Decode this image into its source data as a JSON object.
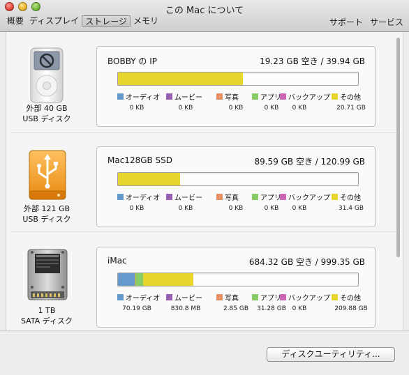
{
  "window": {
    "title": "この Mac について"
  },
  "tabs": [
    {
      "label": "概要"
    },
    {
      "label": "ディスプレイ"
    },
    {
      "label": "ストレージ",
      "active": true
    },
    {
      "label": "メモリ"
    }
  ],
  "header_links": {
    "support": "サポート",
    "service": "サービス"
  },
  "colors": {
    "audio": "#6699cc",
    "movies": "#9a5fb0",
    "photos": "#e58f62",
    "apps": "#88cc66",
    "backups": "#cc66b8",
    "other": "#e6d62e"
  },
  "legend_labels": [
    "オーディオ",
    "ムービー",
    "写真",
    "アプリ",
    "バックアップ",
    "その他"
  ],
  "devices": [
    {
      "icon": "ipod-icon",
      "label_line1": "外部 40 GB",
      "label_line2": "USB ディスク",
      "name": "BOBBY の IP",
      "capacity": "19.23 GB 空き / 39.94 GB",
      "usage_fraction": {
        "audio": 0,
        "movies": 0,
        "photos": 0,
        "apps": 0,
        "backups": 0,
        "other": 0.519
      },
      "values": [
        "0 KB",
        "0 KB",
        "0 KB",
        "0 KB",
        "0 KB",
        "20.71 GB"
      ]
    },
    {
      "icon": "usb-drive-icon",
      "label_line1": "外部 121 GB",
      "label_line2": "USB ディスク",
      "name": "Mac128GB SSD",
      "capacity": "89.59 GB 空き / 120.99 GB",
      "usage_fraction": {
        "audio": 0,
        "movies": 0,
        "photos": 0,
        "apps": 0,
        "backups": 0,
        "other": 0.26
      },
      "values": [
        "0 KB",
        "0 KB",
        "0 KB",
        "0 KB",
        "0 KB",
        "31.4 GB"
      ]
    },
    {
      "icon": "hard-disk-icon",
      "label_line1": "1 TB",
      "label_line2": "SATA ディスク",
      "name": "iMac",
      "capacity": "684.32 GB 空き / 999.35 GB",
      "usage_fraction": {
        "audio": 0.0702,
        "movies": 0.0008,
        "photos": 0.0029,
        "apps": 0.0313,
        "backups": 0,
        "other": 0.21
      },
      "values": [
        "70.19 GB",
        "830.8 MB",
        "2.85 GB",
        "31.28 GB",
        "0 KB",
        "209.88 GB"
      ]
    }
  ],
  "footer": {
    "disk_utility_button": "ディスクユーティリティ..."
  }
}
